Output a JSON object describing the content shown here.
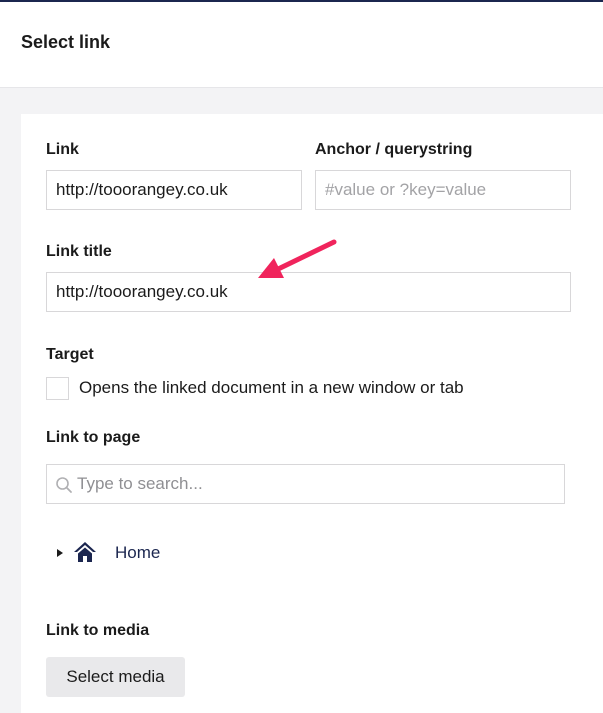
{
  "header": {
    "title": "Select link"
  },
  "link": {
    "label": "Link",
    "value": "http://tooorangey.co.uk"
  },
  "anchor": {
    "label": "Anchor / querystring",
    "placeholder": "#value or ?key=value"
  },
  "link_title": {
    "label": "Link title",
    "value": "http://tooorangey.co.uk"
  },
  "target": {
    "label": "Target",
    "checkbox_label": "Opens the linked document in a new window or tab",
    "checked": false
  },
  "link_to_page": {
    "label": "Link to page",
    "search_placeholder": "Type to search...",
    "tree": [
      {
        "label": "Home",
        "icon": "home-icon"
      }
    ]
  },
  "link_to_media": {
    "label": "Link to media",
    "button_label": "Select media"
  },
  "colors": {
    "accent": "#1b264f",
    "annotation_arrow": "#f0245c"
  }
}
